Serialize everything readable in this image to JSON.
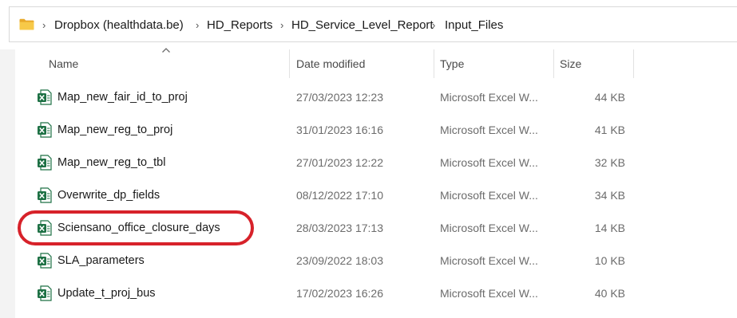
{
  "breadcrumb": {
    "items": [
      {
        "label": "Dropbox (healthdata.be)"
      },
      {
        "label": "HD_Reports"
      },
      {
        "label": "HD_Service_Level_Report"
      },
      {
        "label": "Input_Files"
      }
    ],
    "separator": ">"
  },
  "columns": {
    "name": "Name",
    "date": "Date modified",
    "type": "Type",
    "size": "Size"
  },
  "files": [
    {
      "name": "Map_new_fair_id_to_proj",
      "date": "27/03/2023 12:23",
      "type": "Microsoft Excel W...",
      "size": "44 KB"
    },
    {
      "name": "Map_new_reg_to_proj",
      "date": "31/01/2023 16:16",
      "type": "Microsoft Excel W...",
      "size": "41 KB"
    },
    {
      "name": "Map_new_reg_to_tbl",
      "date": "27/01/2023 12:22",
      "type": "Microsoft Excel W...",
      "size": "32 KB"
    },
    {
      "name": "Overwrite_dp_fields",
      "date": "08/12/2022 17:10",
      "type": "Microsoft Excel W...",
      "size": "34 KB"
    },
    {
      "name": "Sciensano_office_closure_days",
      "date": "28/03/2023 17:13",
      "type": "Microsoft Excel W...",
      "size": "14 KB"
    },
    {
      "name": "SLA_parameters",
      "date": "23/09/2022 18:03",
      "type": "Microsoft Excel W...",
      "size": "10 KB"
    },
    {
      "name": "Update_t_proj_bus",
      "date": "17/02/2023 16:26",
      "type": "Microsoft Excel W...",
      "size": "40 KB"
    }
  ],
  "icons": {
    "folder": "folder-icon",
    "file": "excel-file-icon",
    "sort": "sort-up-caret-icon"
  },
  "colors": {
    "excel_green": "#1e7145",
    "highlight_red": "#d7222a",
    "folder_yellow": "#f2c14e"
  }
}
